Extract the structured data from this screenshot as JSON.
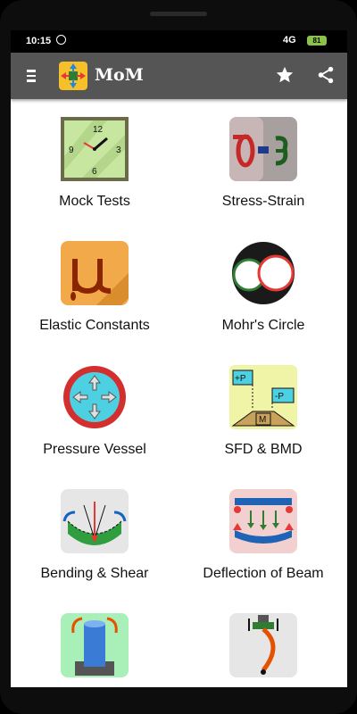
{
  "status_bar": {
    "time": "10:15",
    "signal": "4G",
    "battery": "81"
  },
  "app_bar": {
    "title": "MoM",
    "icons": [
      "menu-icon",
      "app-logo",
      "star-icon",
      "share-icon"
    ]
  },
  "grid": {
    "tiles": [
      {
        "label": "Mock Tests",
        "icon": "clock-icon"
      },
      {
        "label": "Stress-Strain",
        "icon": "stress-strain-icon"
      },
      {
        "label": "Elastic Constants",
        "icon": "mu-icon"
      },
      {
        "label": "Mohr's Circle",
        "icon": "mohr-circle-icon"
      },
      {
        "label": "Pressure Vessel",
        "icon": "pressure-vessel-icon"
      },
      {
        "label": "SFD & BMD",
        "icon": "sfd-bmd-icon"
      },
      {
        "label": "Bending & Shear",
        "icon": "bending-icon"
      },
      {
        "label": "Deflection of Beam",
        "icon": "beam-deflection-icon"
      },
      {
        "label": "",
        "icon": "torsion-icon"
      },
      {
        "label": "",
        "icon": "column-buckling-icon"
      }
    ]
  },
  "colors": {
    "app_bar": "#555555",
    "background": "#ffffff",
    "accent_red": "#e53935",
    "accent_green": "#2e7d32"
  }
}
